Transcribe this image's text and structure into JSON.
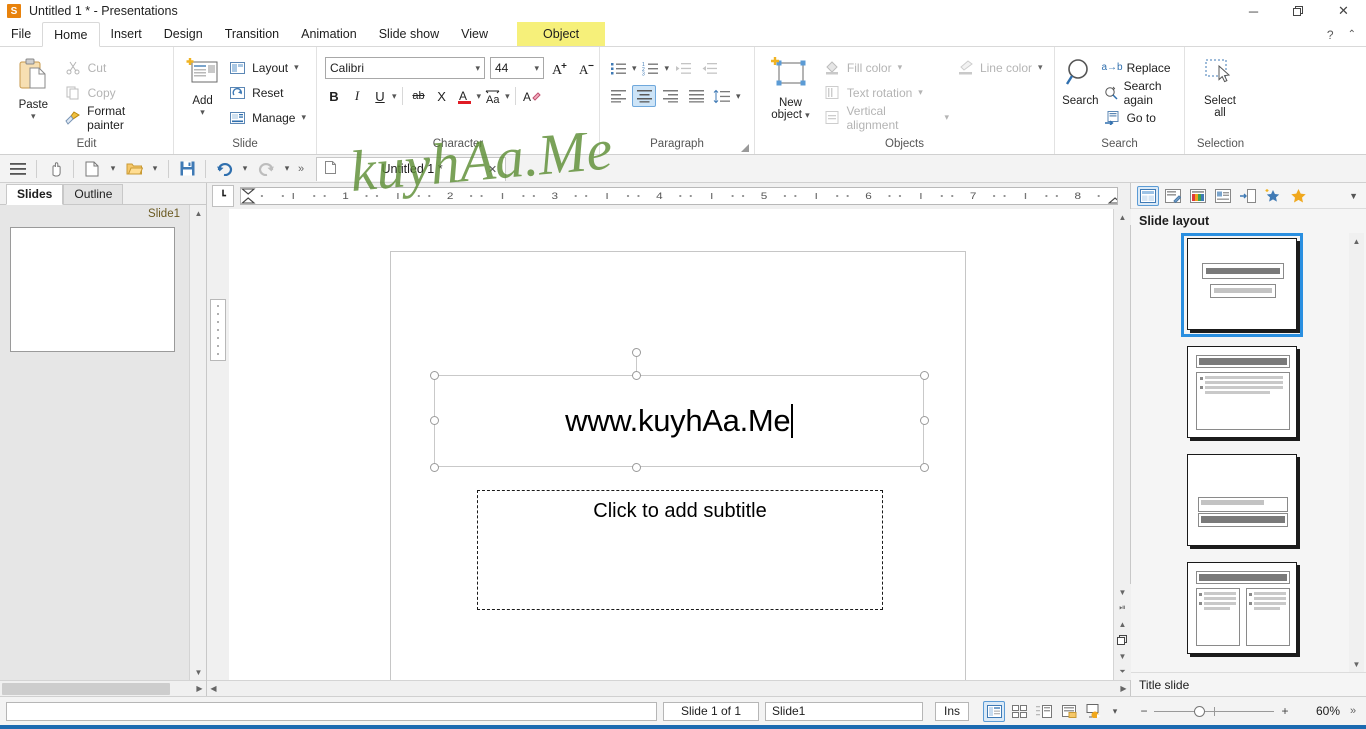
{
  "window": {
    "title": "Untitled 1 * - Presentations",
    "app_icon": "S",
    "minimize": "─",
    "maximize": "❐",
    "close": "✕",
    "help": "?",
    "collapse_ribbon": "⌃"
  },
  "menu": {
    "items": [
      {
        "label": "File",
        "active": false
      },
      {
        "label": "Home",
        "active": true
      },
      {
        "label": "Insert",
        "active": false
      },
      {
        "label": "Design",
        "active": false
      },
      {
        "label": "Transition",
        "active": false
      },
      {
        "label": "Animation",
        "active": false
      },
      {
        "label": "Slide show",
        "active": false
      },
      {
        "label": "View",
        "active": false
      }
    ],
    "context_tab": "Object"
  },
  "ribbon": {
    "groups": [
      {
        "label": "Edit"
      },
      {
        "label": "Slide"
      },
      {
        "label": "Character"
      },
      {
        "label": "Paragraph"
      },
      {
        "label": "Objects"
      },
      {
        "label": "Search"
      },
      {
        "label": "Selection"
      }
    ],
    "edit": {
      "paste": "Paste",
      "cut": "Cut",
      "copy": "Copy",
      "format_painter": "Format painter"
    },
    "slide": {
      "add": "Add",
      "layout": "Layout",
      "reset": "Reset",
      "manage": "Manage"
    },
    "character": {
      "font_name": "Calibri",
      "font_size": "44",
      "grow_font": "A",
      "shrink_font": "A",
      "bold": "B",
      "italic": "I",
      "underline": "U",
      "strikethrough": "ab",
      "shadow": "X",
      "font_color": "A",
      "change_case": "Aa",
      "clear_format": "A"
    },
    "paragraph": {
      "bullets": "bullet-list",
      "numbering": "numbered-list",
      "increase_indent": "increase-indent",
      "decrease_indent": "decrease-indent",
      "align_left": "align-left",
      "align_center": "align-center",
      "align_right": "align-right",
      "justify": "justify",
      "line_spacing": "line-spacing",
      "active_alignment": "align_center"
    },
    "objects": {
      "new_object": "New\nobject",
      "new_object_line1": "New",
      "new_object_line2": "object",
      "fill_color": "Fill color",
      "text_rotation": "Text rotation",
      "vertical_alignment": "Vertical alignment",
      "line_color": "Line color"
    },
    "search": {
      "search": "Search",
      "replace": "Replace",
      "replace_icon": "a→b",
      "search_again": "Search again",
      "go_to": "Go to"
    },
    "selection": {
      "select_all_line1": "Select",
      "select_all_line2": "all"
    }
  },
  "quickbar": {
    "menu_icon": "hamburger-icon",
    "hand_icon": "hand-icon",
    "new_icon": "new-document-icon",
    "open_icon": "open-folder-icon",
    "save_icon": "save-icon",
    "undo_icon": "undo-icon",
    "redo_icon": "redo-icon",
    "overflow": "»",
    "document_tab": "Untitled 1 *",
    "document_tab_close": "✕"
  },
  "left_pane": {
    "tabs": [
      {
        "label": "Slides",
        "active": true
      },
      {
        "label": "Outline",
        "active": false
      }
    ],
    "slide_label": "Slide1"
  },
  "canvas": {
    "ruler_marks": [
      "1",
      "2",
      "3",
      "4",
      "5",
      "6",
      "7",
      "8"
    ],
    "title_text": "www.kuyhAa.Me",
    "subtitle_placeholder": "Click to add subtitle",
    "watermark": "kuyhAa.Me"
  },
  "right_pane": {
    "header_icons": [
      "slide-layout-icon",
      "slide-transition-icon",
      "slide-design-icon",
      "custom-animation-icon",
      "master-slide-icon",
      "animation-star-blue-icon",
      "animation-star-orange-icon"
    ],
    "dropdown_icon": "▼",
    "title": "Slide layout",
    "footer": "Title slide",
    "layouts": [
      {
        "name": "title-slide",
        "selected": true
      },
      {
        "name": "title-content",
        "selected": false
      },
      {
        "name": "centered-text",
        "selected": false
      },
      {
        "name": "two-content",
        "selected": false
      }
    ]
  },
  "status_bar": {
    "slide_counter": "Slide 1 of 1",
    "slide_name": "Slide1",
    "insert_mode": "Ins",
    "view_buttons": [
      {
        "name": "normal-view",
        "selected": true
      },
      {
        "name": "slide-sorter-view",
        "selected": false
      },
      {
        "name": "outline-view",
        "selected": false
      },
      {
        "name": "notes-view",
        "selected": false
      },
      {
        "name": "start-slideshow",
        "selected": false
      }
    ],
    "zoom_out": "−",
    "zoom_in": "+",
    "zoom_level": "60%",
    "overflow": "»"
  },
  "colors": {
    "accent": "#2a8fe0",
    "context_tab": "#f6f07a",
    "watermark_green": "#4e7d2a",
    "selection_blue": "#cde4f7",
    "bottom_edge": "#1c6ab0"
  }
}
